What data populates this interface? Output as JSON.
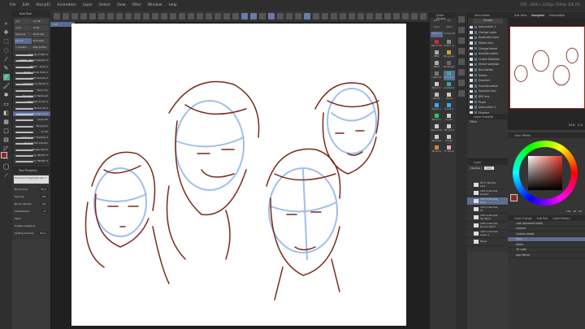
{
  "window": {
    "title": "CSP - 3000 x 2250px 350dpi 100.0%"
  },
  "menu": [
    "File",
    "Edit",
    "Story(E)",
    "Animation",
    "Layer",
    "Select",
    "View",
    "Filter",
    "Window",
    "Help"
  ],
  "canvas_tab": "CSP",
  "subtool": {
    "tab": "Sub Tool",
    "groups": [
      "Cyr",
      "Cy HB",
      "CyrX",
      "Artist",
      "Sparrow",
      "Sketches",
      "Spacer",
      "Smoketa",
      "1 Chealm",
      "Real G-Pen"
    ],
    "brushes": [
      "Gen 6pnt NB2 2",
      "PAINT - Frilled Square 2",
      "PAINT - Sumi 2",
      "PAINT - Drab Fuda 2",
      "Soft strokes 2",
      "CRAYP Pencil Black 2",
      "Pencil tin",
      "Thick Pencil Textured",
      "Rougher brush 2",
      "Pencil_dk 2",
      "Frenzum's Highlight pen",
      "Lasso fill",
      "Bong pen",
      "Cr Ch",
      "Ollame Cel Shading 2",
      "Hi Graphite Powder",
      "Hedge Pencil",
      "Cy HB INT 2",
      "Cy HB INT 3"
    ],
    "selected": "Frenzum's Highlight pen"
  },
  "tool_property": {
    "tab": "Tool Property",
    "tool_name": "Frenzum's Highlight pen 2",
    "rows": [
      {
        "label": "Brush Size",
        "value": "80.0"
      },
      {
        "label": "Opacity",
        "value": "100"
      },
      {
        "label": "Brush density",
        "value": "100"
      },
      {
        "label": "Stabilization",
        "value": "27"
      },
      {
        "label": "Taper",
        "value": ""
      }
    ],
    "snapping": "Enable snapping",
    "setting_label": "Setting anchors",
    "setting_value": "None"
  },
  "colors": {
    "main": "#8b2a1c",
    "sub": "#ffffff",
    "accent": "#5a6b95",
    "line": "#7a2a1a",
    "guide": "#8fb4e6"
  },
  "quick_access": {
    "tab": "Quick Access",
    "sets": [
      "Set 1",
      "Ink",
      "Color",
      "Set 2",
      "Basic 1",
      "Composite"
    ],
    "items": [
      "Pencil 50",
      "Eraser 1L",
      "HBPI",
      "Bong pen",
      "HB25",
      "Rectangle",
      "Lasso fill",
      "Selection",
      "Blurs Cr",
      "Gradient",
      "Rough",
      "Hand",
      "Gyrob 1",
      "Gyrob 2",
      "Pencil 1",
      "G-pen",
      "Real G-Pe",
      "HB pen 2",
      "Textured",
      "Rough pen",
      "Marking",
      "TT Pencil"
    ]
  },
  "auto_action": {
    "tab": "Auto Action",
    "set": "Private",
    "items": [
      "Auto action 1",
      "Change Layer",
      "Duplicate Layer",
      "Motion blur",
      "Change blendi",
      "Hue/Saturation",
      "Create Selection",
      "Shrink selection",
      "Blur border",
      "Delete",
      "Deselect",
      "Hue/Saturation",
      "Gaussian blur",
      "RPG line",
      "Paper",
      "Auto action 2",
      "Shading"
    ]
  },
  "navigator": {
    "tabs": [
      "Sub View",
      "Navigator",
      "Information"
    ],
    "zoom": "24.8",
    "angle": "0.0"
  },
  "layer_property": {
    "tab": "Layer Property",
    "effect": "Effect"
  },
  "layers": {
    "tab": "Layer",
    "blend": "Normal",
    "opacity": "100",
    "items": [
      {
        "meta": "80 % Normal",
        "name": "Line"
      },
      {
        "meta": "100 % Normal",
        "name": "Lineart"
      },
      {
        "meta": "100 % Normal",
        "name": "Face"
      },
      {
        "meta": "100 % Normal",
        "name": "W"
      },
      {
        "meta": "100 % Normal",
        "name": "Sg demo"
      },
      {
        "meta": "100 % Normal",
        "name": "Round demo"
      },
      {
        "meta": "100 % Normal",
        "name": "Layer 1"
      },
      {
        "meta": "",
        "name": "Paper"
      }
    ],
    "selected": 2
  },
  "color_wheel": {
    "tab": "Color Wheel",
    "r": "138",
    "g": "44",
    "b": "22"
  },
  "layer_comp": {
    "tabs": [
      "Layer Comps",
      "Sub Tool",
      "Color History"
    ],
    "items": [
      "Last document state",
      "Lorerno",
      "Lorerno adapt",
      "Face",
      "demo",
      "3d cube",
      "sign demo"
    ],
    "selected": 3
  }
}
